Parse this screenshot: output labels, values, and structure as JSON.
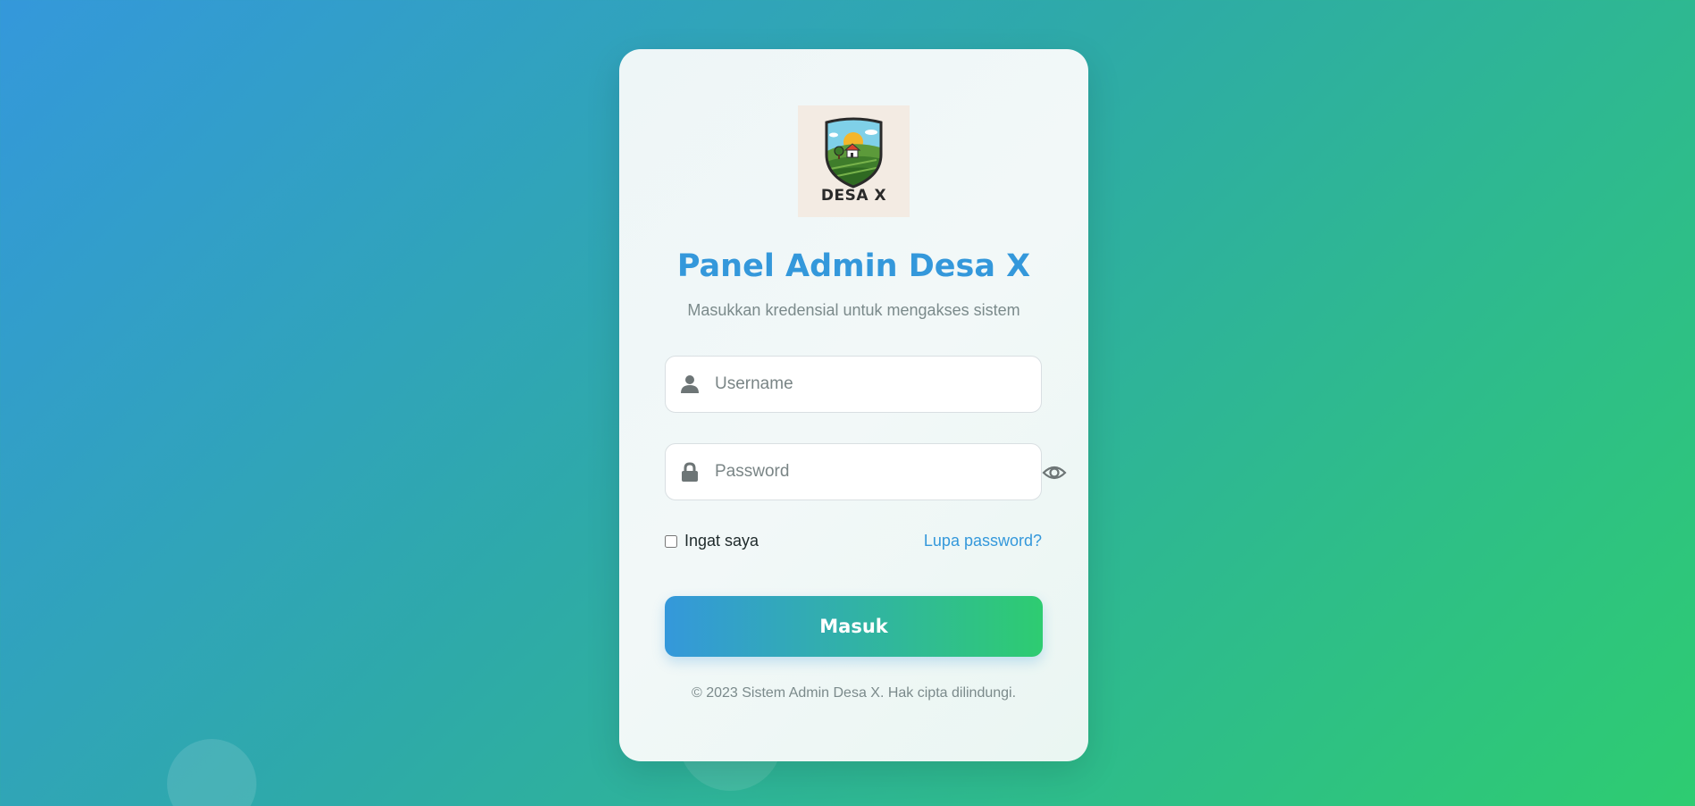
{
  "logo": {
    "text": "DESA X"
  },
  "login": {
    "title": "Panel Admin Desa X",
    "subtitle": "Masukkan kredensial untuk mengakses sistem",
    "username_placeholder": "Username",
    "password_placeholder": "Password",
    "remember_label": "Ingat saya",
    "forgot_label": "Lupa password?",
    "submit_label": "Masuk",
    "footer": "© 2023 Sistem Admin Desa X. Hak cipta dilindungi."
  },
  "icons": {
    "username": "user-icon",
    "password": "lock-icon",
    "toggle": "eye-icon"
  },
  "colors": {
    "accent": "#3498db",
    "accent_end": "#2ecc71",
    "muted_text": "#7b8a8b"
  }
}
